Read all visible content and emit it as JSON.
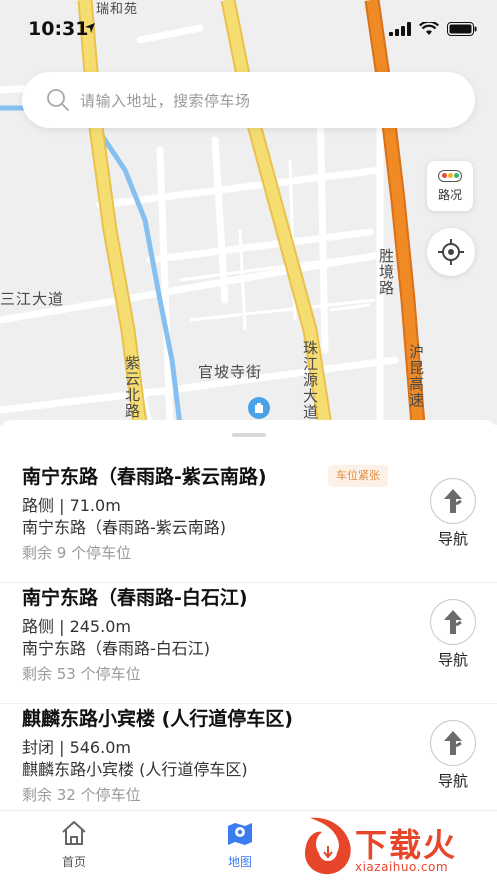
{
  "status_bar": {
    "time": "10:31"
  },
  "search": {
    "placeholder": "请输入地址，搜索停车场"
  },
  "map": {
    "traffic_label": "路况",
    "labels": {
      "top_road": "瑞和苑",
      "sanjiang": "三江大道",
      "shengjing": "胜境路",
      "ziyun_bei": "紫云北路",
      "guanpo": "官坡寺街",
      "zhujiangyuan": "珠江源大道",
      "hukun": "沪昆高速"
    }
  },
  "parking_list": [
    {
      "title": "南宁东路（春雨路-紫云南路)",
      "badge": "车位紧张",
      "type_distance": "路侧 | 71.0m",
      "address": "南宁东路（春雨路-紫云南路)",
      "remaining": "剩余 9 个停车位",
      "nav_label": "导航"
    },
    {
      "title": "南宁东路（春雨路-白石江)",
      "badge": "",
      "type_distance": "路侧 | 245.0m",
      "address": "南宁东路（春雨路-白石江)",
      "remaining": "剩余 53 个停车位",
      "nav_label": "导航"
    },
    {
      "title": "麒麟东路小宾楼 (人行道停车区)",
      "badge": "",
      "type_distance": "封闭 | 546.0m",
      "address": "麒麟东路小宾楼 (人行道停车区)",
      "remaining": "剩余 32 个停车位",
      "nav_label": "导航"
    }
  ],
  "tabs": [
    {
      "label": "首页",
      "icon": "home-icon",
      "active": false
    },
    {
      "label": "地图",
      "icon": "map-icon",
      "active": true
    }
  ],
  "watermark": {
    "text": "下载火",
    "url": "xiazaihuo.com"
  },
  "colors": {
    "accent": "#3b7cf0",
    "badge_text": "#e08a3c",
    "badge_bg": "#fdf1e7",
    "highway": "#f08a24",
    "main_road": "#f5dd72",
    "river": "#86c0f0",
    "watermark": "#e8462a"
  }
}
